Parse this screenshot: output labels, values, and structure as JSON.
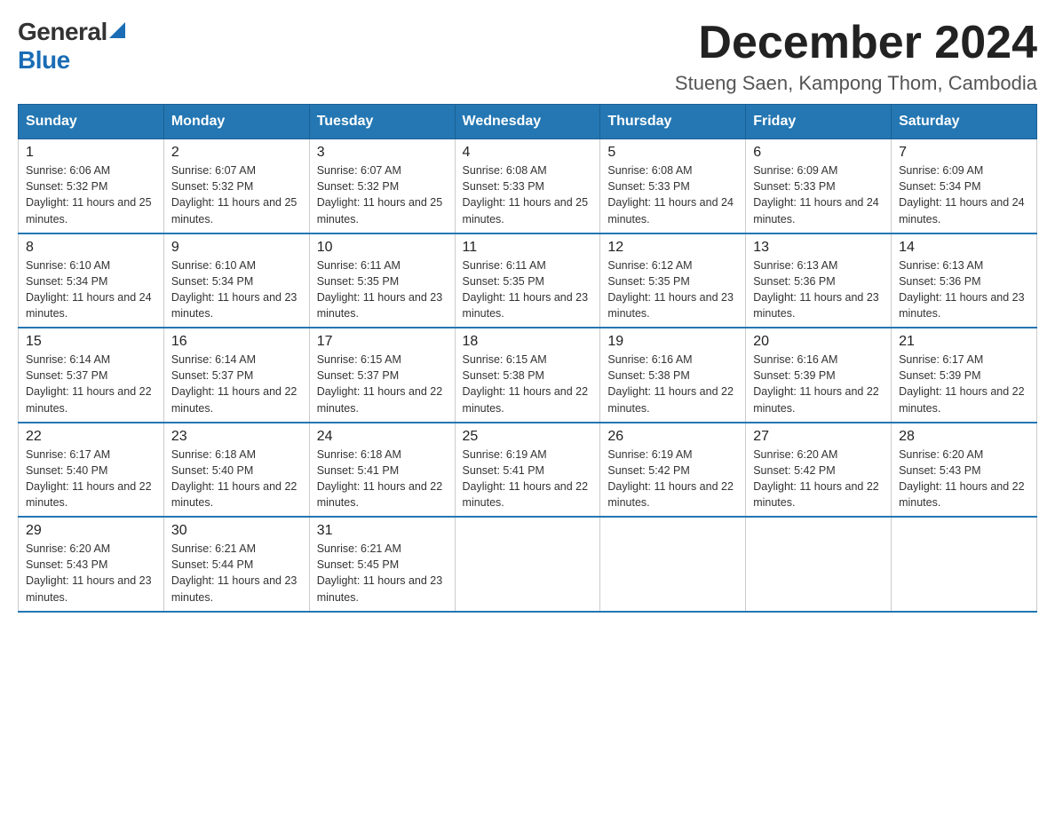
{
  "logo": {
    "general": "General",
    "blue": "Blue"
  },
  "title": "December 2024",
  "location": "Stueng Saen, Kampong Thom, Cambodia",
  "days_of_week": [
    "Sunday",
    "Monday",
    "Tuesday",
    "Wednesday",
    "Thursday",
    "Friday",
    "Saturday"
  ],
  "weeks": [
    [
      {
        "day": "1",
        "sunrise": "6:06 AM",
        "sunset": "5:32 PM",
        "daylight": "11 hours and 25 minutes."
      },
      {
        "day": "2",
        "sunrise": "6:07 AM",
        "sunset": "5:32 PM",
        "daylight": "11 hours and 25 minutes."
      },
      {
        "day": "3",
        "sunrise": "6:07 AM",
        "sunset": "5:32 PM",
        "daylight": "11 hours and 25 minutes."
      },
      {
        "day": "4",
        "sunrise": "6:08 AM",
        "sunset": "5:33 PM",
        "daylight": "11 hours and 25 minutes."
      },
      {
        "day": "5",
        "sunrise": "6:08 AM",
        "sunset": "5:33 PM",
        "daylight": "11 hours and 24 minutes."
      },
      {
        "day": "6",
        "sunrise": "6:09 AM",
        "sunset": "5:33 PM",
        "daylight": "11 hours and 24 minutes."
      },
      {
        "day": "7",
        "sunrise": "6:09 AM",
        "sunset": "5:34 PM",
        "daylight": "11 hours and 24 minutes."
      }
    ],
    [
      {
        "day": "8",
        "sunrise": "6:10 AM",
        "sunset": "5:34 PM",
        "daylight": "11 hours and 24 minutes."
      },
      {
        "day": "9",
        "sunrise": "6:10 AM",
        "sunset": "5:34 PM",
        "daylight": "11 hours and 23 minutes."
      },
      {
        "day": "10",
        "sunrise": "6:11 AM",
        "sunset": "5:35 PM",
        "daylight": "11 hours and 23 minutes."
      },
      {
        "day": "11",
        "sunrise": "6:11 AM",
        "sunset": "5:35 PM",
        "daylight": "11 hours and 23 minutes."
      },
      {
        "day": "12",
        "sunrise": "6:12 AM",
        "sunset": "5:35 PM",
        "daylight": "11 hours and 23 minutes."
      },
      {
        "day": "13",
        "sunrise": "6:13 AM",
        "sunset": "5:36 PM",
        "daylight": "11 hours and 23 minutes."
      },
      {
        "day": "14",
        "sunrise": "6:13 AM",
        "sunset": "5:36 PM",
        "daylight": "11 hours and 23 minutes."
      }
    ],
    [
      {
        "day": "15",
        "sunrise": "6:14 AM",
        "sunset": "5:37 PM",
        "daylight": "11 hours and 22 minutes."
      },
      {
        "day": "16",
        "sunrise": "6:14 AM",
        "sunset": "5:37 PM",
        "daylight": "11 hours and 22 minutes."
      },
      {
        "day": "17",
        "sunrise": "6:15 AM",
        "sunset": "5:37 PM",
        "daylight": "11 hours and 22 minutes."
      },
      {
        "day": "18",
        "sunrise": "6:15 AM",
        "sunset": "5:38 PM",
        "daylight": "11 hours and 22 minutes."
      },
      {
        "day": "19",
        "sunrise": "6:16 AM",
        "sunset": "5:38 PM",
        "daylight": "11 hours and 22 minutes."
      },
      {
        "day": "20",
        "sunrise": "6:16 AM",
        "sunset": "5:39 PM",
        "daylight": "11 hours and 22 minutes."
      },
      {
        "day": "21",
        "sunrise": "6:17 AM",
        "sunset": "5:39 PM",
        "daylight": "11 hours and 22 minutes."
      }
    ],
    [
      {
        "day": "22",
        "sunrise": "6:17 AM",
        "sunset": "5:40 PM",
        "daylight": "11 hours and 22 minutes."
      },
      {
        "day": "23",
        "sunrise": "6:18 AM",
        "sunset": "5:40 PM",
        "daylight": "11 hours and 22 minutes."
      },
      {
        "day": "24",
        "sunrise": "6:18 AM",
        "sunset": "5:41 PM",
        "daylight": "11 hours and 22 minutes."
      },
      {
        "day": "25",
        "sunrise": "6:19 AM",
        "sunset": "5:41 PM",
        "daylight": "11 hours and 22 minutes."
      },
      {
        "day": "26",
        "sunrise": "6:19 AM",
        "sunset": "5:42 PM",
        "daylight": "11 hours and 22 minutes."
      },
      {
        "day": "27",
        "sunrise": "6:20 AM",
        "sunset": "5:42 PM",
        "daylight": "11 hours and 22 minutes."
      },
      {
        "day": "28",
        "sunrise": "6:20 AM",
        "sunset": "5:43 PM",
        "daylight": "11 hours and 22 minutes."
      }
    ],
    [
      {
        "day": "29",
        "sunrise": "6:20 AM",
        "sunset": "5:43 PM",
        "daylight": "11 hours and 23 minutes."
      },
      {
        "day": "30",
        "sunrise": "6:21 AM",
        "sunset": "5:44 PM",
        "daylight": "11 hours and 23 minutes."
      },
      {
        "day": "31",
        "sunrise": "6:21 AM",
        "sunset": "5:45 PM",
        "daylight": "11 hours and 23 minutes."
      },
      null,
      null,
      null,
      null
    ]
  ]
}
